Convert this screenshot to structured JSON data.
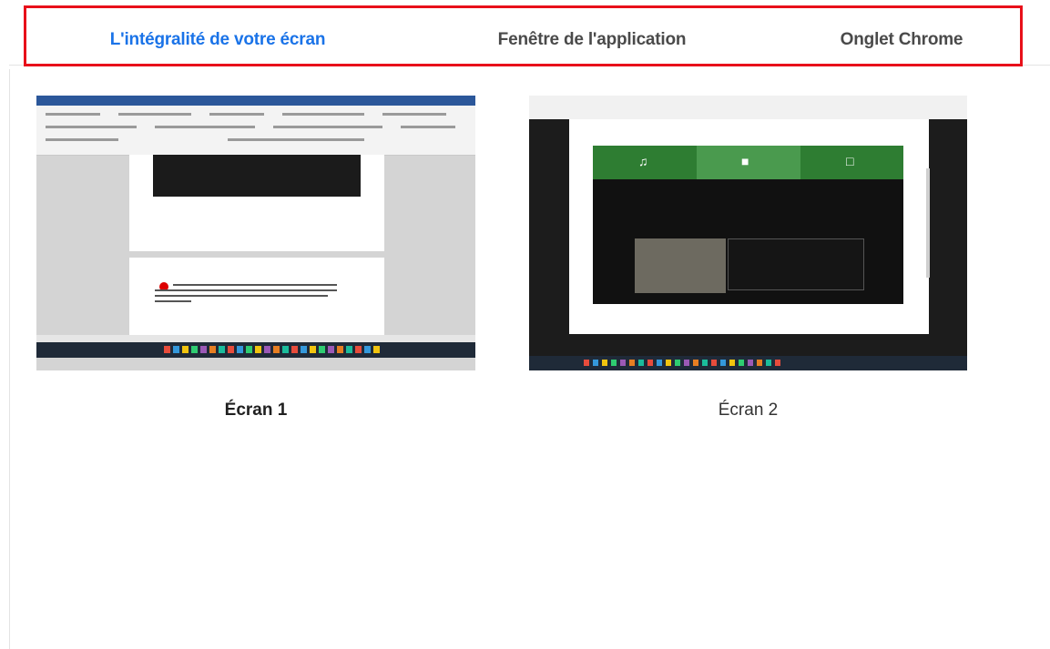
{
  "tabs": [
    {
      "label": "L'intégralité de votre écran",
      "active": true
    },
    {
      "label": "Fenêtre de l'application",
      "active": false
    },
    {
      "label": "Onglet Chrome",
      "active": false
    }
  ],
  "screens": [
    {
      "label": "Écran 1",
      "selected": true
    },
    {
      "label": "Écran 2",
      "selected": false
    }
  ],
  "colors": {
    "accent": "#1a73e8",
    "highlight_box": "#e8101a",
    "meet_green": "#2e7d32"
  }
}
